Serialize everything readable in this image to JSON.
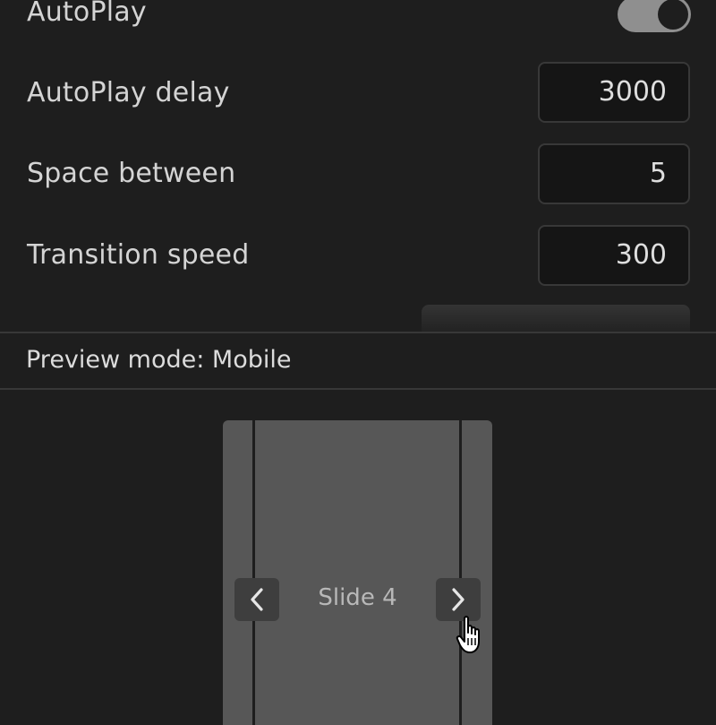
{
  "settings": {
    "autoplay": {
      "label": "AutoPlay",
      "enabled": true
    },
    "autoplay_delay": {
      "label": "AutoPlay delay",
      "value": "3000"
    },
    "space_between": {
      "label": "Space between",
      "value": "5"
    },
    "transition_speed": {
      "label": "Transition speed",
      "value": "300"
    }
  },
  "preview": {
    "mode_label": "Preview mode: Mobile",
    "slide_label": "Slide 4"
  },
  "icons": {
    "prev": "chevron-left-icon",
    "next": "chevron-right-icon",
    "cursor": "hand-pointer-icon"
  },
  "colors": {
    "background": "#1e1e1e",
    "toggle_on": "#8f8f8f",
    "input_bg": "#151515",
    "slide_bg": "#575757"
  }
}
